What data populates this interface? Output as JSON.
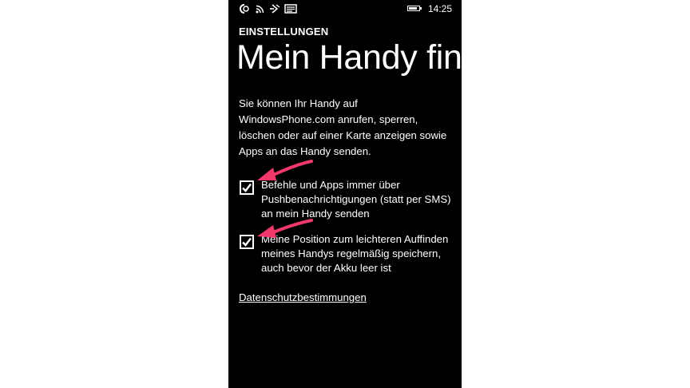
{
  "status_bar": {
    "time": "14:25",
    "icons": [
      "nfc-icon",
      "wifi-icon",
      "signal-icon",
      "message-icon"
    ],
    "battery_level": 0.85
  },
  "header": {
    "app_title": "EINSTELLUNGEN",
    "page_title": "Mein Handy finden"
  },
  "intro_text": "Sie können Ihr Handy auf WindowsPhone.com anrufen, sperren, löschen oder auf einer Karte anzeigen sowie Apps an das Handy senden.",
  "options": [
    {
      "label": "Befehle und Apps immer über Pushbenachrichtigungen (statt per SMS) an mein Handy senden",
      "checked": true
    },
    {
      "label": "Meine Position zum leichteren Auffinden meines Handys regelmäßig speichern, auch bevor der Akku leer ist",
      "checked": true
    }
  ],
  "privacy_link": "Datenschutzbestimmungen",
  "colors": {
    "background": "#000000",
    "text": "#ffffff",
    "annotation_arrow": "#f0386b"
  }
}
